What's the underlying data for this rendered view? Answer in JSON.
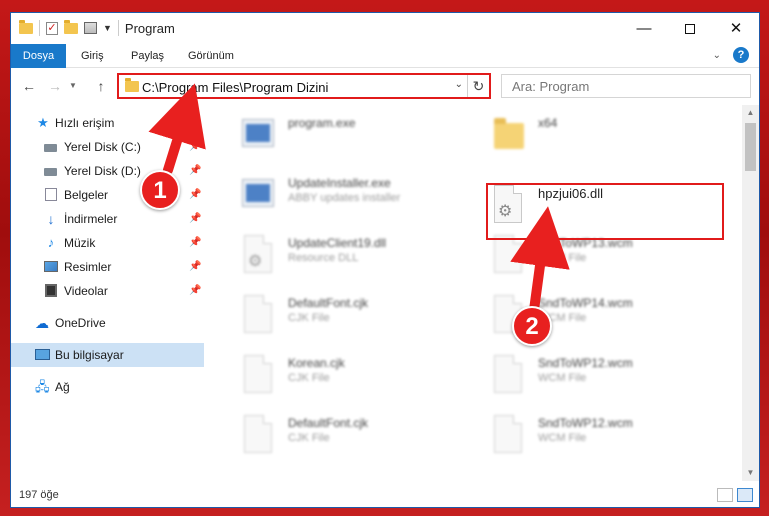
{
  "window": {
    "title": "Program",
    "controls": {
      "minimize": "—",
      "maximize": "",
      "close": "✕"
    }
  },
  "ribbon": {
    "tabs": [
      "Dosya",
      "Giriş",
      "Paylaş",
      "Görünüm"
    ],
    "help": "?"
  },
  "navigation": {
    "address": "C:\\Program Files\\Program Dizini",
    "search_placeholder": "Ara: Program"
  },
  "sidebar": {
    "items": [
      {
        "label": "Hızlı erişim",
        "icon": "star-icon"
      },
      {
        "label": "Yerel Disk (C:)",
        "icon": "disk-icon",
        "pinned": true
      },
      {
        "label": "Yerel Disk (D:)",
        "icon": "disk-icon",
        "pinned": true
      },
      {
        "label": "Belgeler",
        "icon": "documents-icon",
        "pinned": true
      },
      {
        "label": "İndirmeler",
        "icon": "downloads-icon",
        "pinned": true
      },
      {
        "label": "Müzik",
        "icon": "music-icon",
        "pinned": true
      },
      {
        "label": "Resimler",
        "icon": "pictures-icon",
        "pinned": true
      },
      {
        "label": "Videolar",
        "icon": "videos-icon",
        "pinned": true
      },
      {
        "label": "OneDrive",
        "icon": "onedrive-icon"
      },
      {
        "label": "Bu bilgisayar",
        "icon": "this-pc-icon",
        "selected": true
      },
      {
        "label": "Ağ",
        "icon": "network-icon"
      }
    ]
  },
  "files": [
    {
      "name": "program.exe",
      "type": "",
      "icon": "exe-icon"
    },
    {
      "name": "x64",
      "type": "",
      "icon": "folder-icon"
    },
    {
      "name": "UpdateInstaller.exe",
      "type": "ABBY updates installer",
      "icon": "exe-icon"
    },
    {
      "name": "hpzjui06.dll",
      "type": "",
      "icon": "dll-gear-icon",
      "highlighted": true
    },
    {
      "name": "UpdateClient19.dll",
      "type": "Resource DLL",
      "icon": "dll-gear-icon"
    },
    {
      "name": "SndToWP13.wcm",
      "type": "WCM File",
      "icon": "file-icon"
    },
    {
      "name": "DefaultFont.cjk",
      "type": "CJK File",
      "icon": "file-icon"
    },
    {
      "name": "SndToWP14.wcm",
      "type": "WCM File",
      "icon": "file-icon"
    },
    {
      "name": "Korean.cjk",
      "type": "CJK File",
      "icon": "file-icon"
    },
    {
      "name": "SndToWP12.wcm",
      "type": "WCM File",
      "icon": "file-icon"
    },
    {
      "name": "DefaultFont.cjk",
      "type": "CJK File",
      "icon": "file-icon"
    },
    {
      "name": "SndToWP12.wcm",
      "type": "WCM File",
      "icon": "file-icon"
    }
  ],
  "status": {
    "count": "197 öğe"
  },
  "callouts": [
    "1",
    "2"
  ],
  "colors": {
    "accent": "#1979ca",
    "highlight": "#e11b1b",
    "selected": "#cce1f5"
  }
}
